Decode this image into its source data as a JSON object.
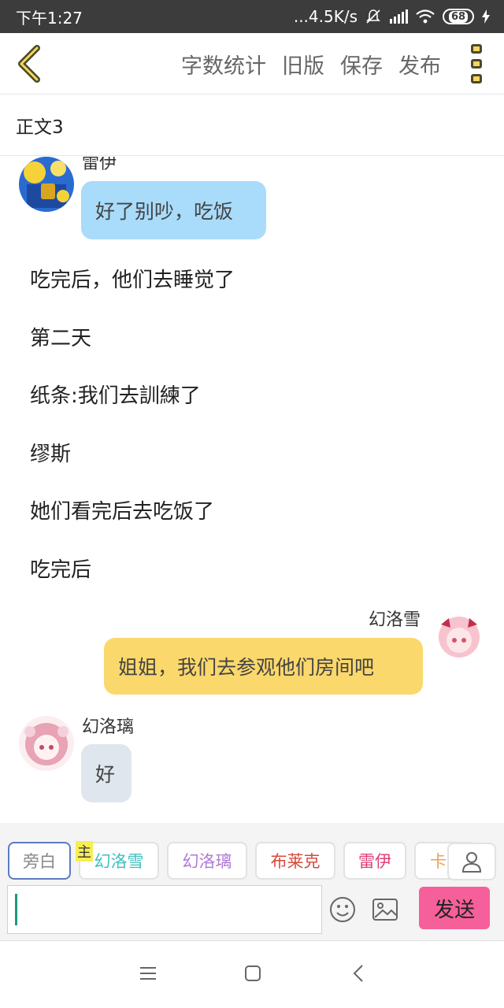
{
  "status": {
    "time": "下午1:27",
    "net_speed": "...4.5K/s",
    "battery": "68"
  },
  "header": {
    "actions": [
      "字数统计",
      "旧版",
      "保存",
      "发布"
    ]
  },
  "chapter": {
    "title": "正文3"
  },
  "messages": {
    "m1": {
      "speaker": "雷伊",
      "text": "好了别吵，吃饭"
    },
    "narration": [
      "吃完后，他们去睡觉了",
      "第二天",
      "纸条:我们去訓練了",
      "缪斯",
      "她们看完后去吃饭了",
      "吃完后"
    ],
    "m2": {
      "speaker": "幻洛雪",
      "text": "姐姐，我们去参观他们房间吧"
    },
    "m3": {
      "speaker": "幻洛璃",
      "text": "好"
    }
  },
  "characters": {
    "owner_tag": "主",
    "chips": [
      {
        "label": "旁白",
        "color": "#888888"
      },
      {
        "label": "幻洛雪",
        "color": "#3fbfbf"
      },
      {
        "label": "幻洛璃",
        "color": "#b07ad6"
      },
      {
        "label": "布莱克",
        "color": "#d64a3a"
      },
      {
        "label": "雷伊",
        "color": "#e0407a"
      },
      {
        "label": "卡",
        "color": "#f0a050"
      }
    ]
  },
  "input": {
    "value": "",
    "send_label": "发送"
  },
  "colors": {
    "bubble_left": "#a9dcfb",
    "bubble_right": "#fbd86c",
    "bubble_grey": "#dfe6ee",
    "send": "#f5609a"
  }
}
